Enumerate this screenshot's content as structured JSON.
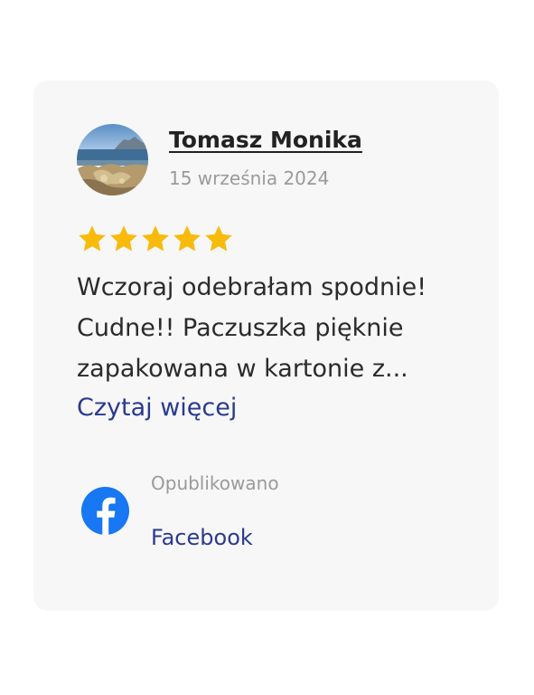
{
  "review": {
    "reviewer_name": "Tomasz Monika",
    "date": "15 września 2024",
    "rating": 5,
    "rating_max": 5,
    "star_color": "#f8bb0c",
    "text": "Wczoraj odebrałam spodnie! Cudne!! Paczuszka pięknie zapakowana w kartonie z...",
    "read_more": "Czytaj więcej"
  },
  "source": {
    "label": "Opublikowano",
    "name": "Facebook",
    "icon": "facebook-icon",
    "color": "#1877f2"
  },
  "colors": {
    "card_background": "#f7f7f7",
    "link": "#2a3a8f"
  }
}
